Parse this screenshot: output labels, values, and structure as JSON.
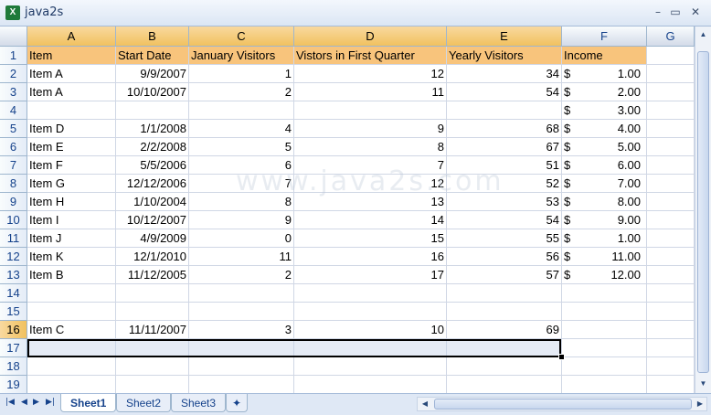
{
  "window": {
    "title": "java2s",
    "app_icon_letter": "X",
    "min": "–",
    "max": "▭",
    "close": "✕"
  },
  "columns": [
    "A",
    "B",
    "C",
    "D",
    "E",
    "F",
    "G"
  ],
  "header_row": [
    "Item",
    "Start Date",
    "January Visitors",
    "Vistors in First Quarter",
    "Yearly Visitors",
    "Income"
  ],
  "rows": [
    {
      "num": "1"
    },
    {
      "num": "2",
      "item": "Item A",
      "date": "9/9/2007",
      "jan": "1",
      "q1": "12",
      "year": "34",
      "income": "1.00"
    },
    {
      "num": "3",
      "item": "Item A",
      "date": "10/10/2007",
      "jan": "2",
      "q1": "11",
      "year": "54",
      "income": "2.00"
    },
    {
      "num": "4",
      "item": "",
      "date": "",
      "jan": "",
      "q1": "",
      "year": "",
      "income": "3.00"
    },
    {
      "num": "5",
      "item": "Item D",
      "date": "1/1/2008",
      "jan": "4",
      "q1": "9",
      "year": "68",
      "income": "4.00"
    },
    {
      "num": "6",
      "item": "Item E",
      "date": "2/2/2008",
      "jan": "5",
      "q1": "8",
      "year": "67",
      "income": "5.00"
    },
    {
      "num": "7",
      "item": "Item F",
      "date": "5/5/2006",
      "jan": "6",
      "q1": "7",
      "year": "51",
      "income": "6.00"
    },
    {
      "num": "8",
      "item": "Item G",
      "date": "12/12/2006",
      "jan": "7",
      "q1": "12",
      "year": "52",
      "income": "7.00"
    },
    {
      "num": "9",
      "item": "Item H",
      "date": "1/10/2004",
      "jan": "8",
      "q1": "13",
      "year": "53",
      "income": "8.00"
    },
    {
      "num": "10",
      "item": "Item I",
      "date": "10/12/2007",
      "jan": "9",
      "q1": "14",
      "year": "54",
      "income": "9.00"
    },
    {
      "num": "11",
      "item": "Item J",
      "date": "4/9/2009",
      "jan": "0",
      "q1": "15",
      "year": "55",
      "income": "1.00"
    },
    {
      "num": "12",
      "item": "Item K",
      "date": "12/1/2010",
      "jan": "11",
      "q1": "16",
      "year": "56",
      "income": "11.00"
    },
    {
      "num": "13",
      "item": "Item B",
      "date": "11/12/2005",
      "jan": "2",
      "q1": "17",
      "year": "57",
      "income": "12.00"
    },
    {
      "num": "14"
    },
    {
      "num": "15"
    },
    {
      "num": "16",
      "item": "Item C",
      "date": "11/11/2007",
      "jan": "3",
      "q1": "10",
      "year": "69"
    },
    {
      "num": "17"
    },
    {
      "num": "18"
    },
    {
      "num": "19"
    }
  ],
  "currency_symbol": "$",
  "watermark": "www.java2s.com",
  "sheets": [
    "Sheet1",
    "Sheet2",
    "Sheet3"
  ],
  "active_sheet": "Sheet1",
  "nav_icons": [
    "first-sheet-icon",
    "prev-sheet-icon",
    "next-sheet-icon",
    "last-sheet-icon"
  ],
  "nav_glyphs": [
    "|◀",
    "◀",
    "▶",
    "▶|"
  ],
  "colors": {
    "header_fill": "#f8c47c",
    "selection_header": "#f1c15f",
    "grid_line": "#d0d7e5"
  }
}
